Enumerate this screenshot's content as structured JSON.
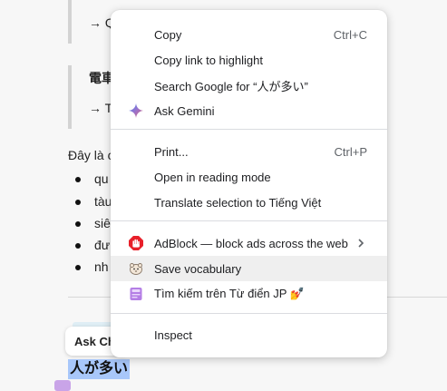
{
  "background": {
    "quote1_text": "→ Q",
    "quote2_heading": "電車",
    "quote2_text": "→ Ta",
    "paragraph": "Đây là c",
    "bullets": [
      "qu",
      "tàu",
      "siê",
      "đư",
      "nh"
    ],
    "ask_chip_label": "Ask Ch",
    "selected_title": "人が多い"
  },
  "context_menu": {
    "groups": [
      {
        "items": [
          {
            "label": "Copy",
            "shortcut": "Ctrl+C"
          },
          {
            "label": "Copy link to highlight",
            "shortcut": ""
          },
          {
            "label": "Search Google for “人が多い”",
            "shortcut": ""
          },
          {
            "label": "Ask Gemini",
            "shortcut": "",
            "icon": "gemini-icon"
          }
        ]
      },
      {
        "items": [
          {
            "label": "Print...",
            "shortcut": "Ctrl+P"
          },
          {
            "label": "Open in reading mode",
            "shortcut": ""
          },
          {
            "label": "Translate selection to Tiếng Việt",
            "shortcut": ""
          }
        ]
      },
      {
        "items": [
          {
            "label": "AdBlock — block ads across the web",
            "shortcut": "",
            "icon": "adblock-icon",
            "submenu": true
          },
          {
            "label": "Save vocabulary",
            "shortcut": "",
            "icon": "save-vocabulary-icon",
            "hovered": true
          },
          {
            "label": "Tìm kiếm trên Từ điển JP 💅",
            "shortcut": "",
            "icon": "jp-dictionary-icon"
          }
        ]
      },
      {
        "items": [
          {
            "label": "Inspect",
            "shortcut": ""
          }
        ]
      }
    ]
  },
  "colors": {
    "menu_bg": "#ffffff",
    "hover_bg": "#efefef",
    "selection_bg": "#a8c7fa",
    "adblock_red": "#e8202a"
  }
}
